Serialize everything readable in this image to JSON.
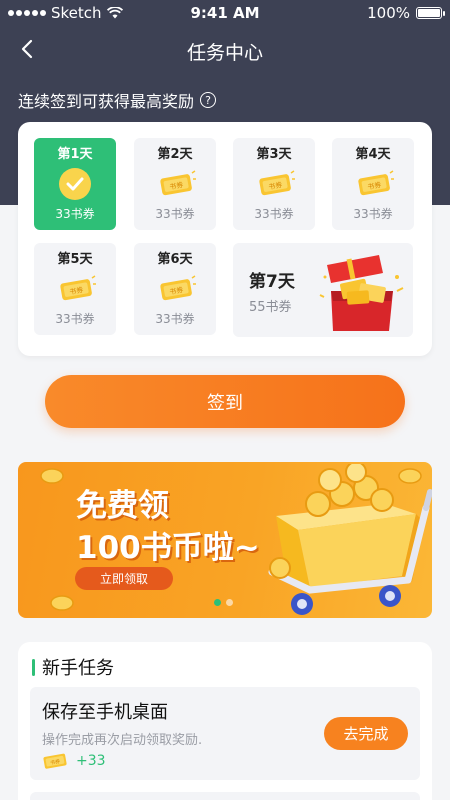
{
  "status_bar": {
    "carrier": "Sketch",
    "time": "9:41 AM",
    "battery": "100%",
    "battery_level": 1.0
  },
  "nav": {
    "title": "任务中心"
  },
  "checkin": {
    "streak_text": "连续签到可获得最高奖励",
    "days": [
      {
        "label": "第1天",
        "reward": "33书券",
        "checked": true
      },
      {
        "label": "第2天",
        "reward": "33书券",
        "checked": false
      },
      {
        "label": "第3天",
        "reward": "33书券",
        "checked": false
      },
      {
        "label": "第4天",
        "reward": "33书券",
        "checked": false
      },
      {
        "label": "第5天",
        "reward": "33书券",
        "checked": false
      },
      {
        "label": "第6天",
        "reward": "33书券",
        "checked": false
      },
      {
        "label": "第7天",
        "reward": "55书券",
        "checked": false
      }
    ],
    "ticket_text": "书券",
    "button_label": "签到"
  },
  "banner": {
    "line1": "免费领",
    "line2": "100书币啦~",
    "button": "立即领取",
    "active_index": 0,
    "total_slides": 2
  },
  "tasks": {
    "section_title": "新手任务",
    "items": [
      {
        "title": "保存至手机桌面",
        "description": "操作完成再次启动领取奖励.",
        "reward": "+33",
        "ticket_text": "书券",
        "action": "去完成"
      }
    ]
  },
  "colors": {
    "header": "#3d4154",
    "green": "#2ebf77",
    "orange": "#f6721a",
    "gold": "#f9c531"
  }
}
